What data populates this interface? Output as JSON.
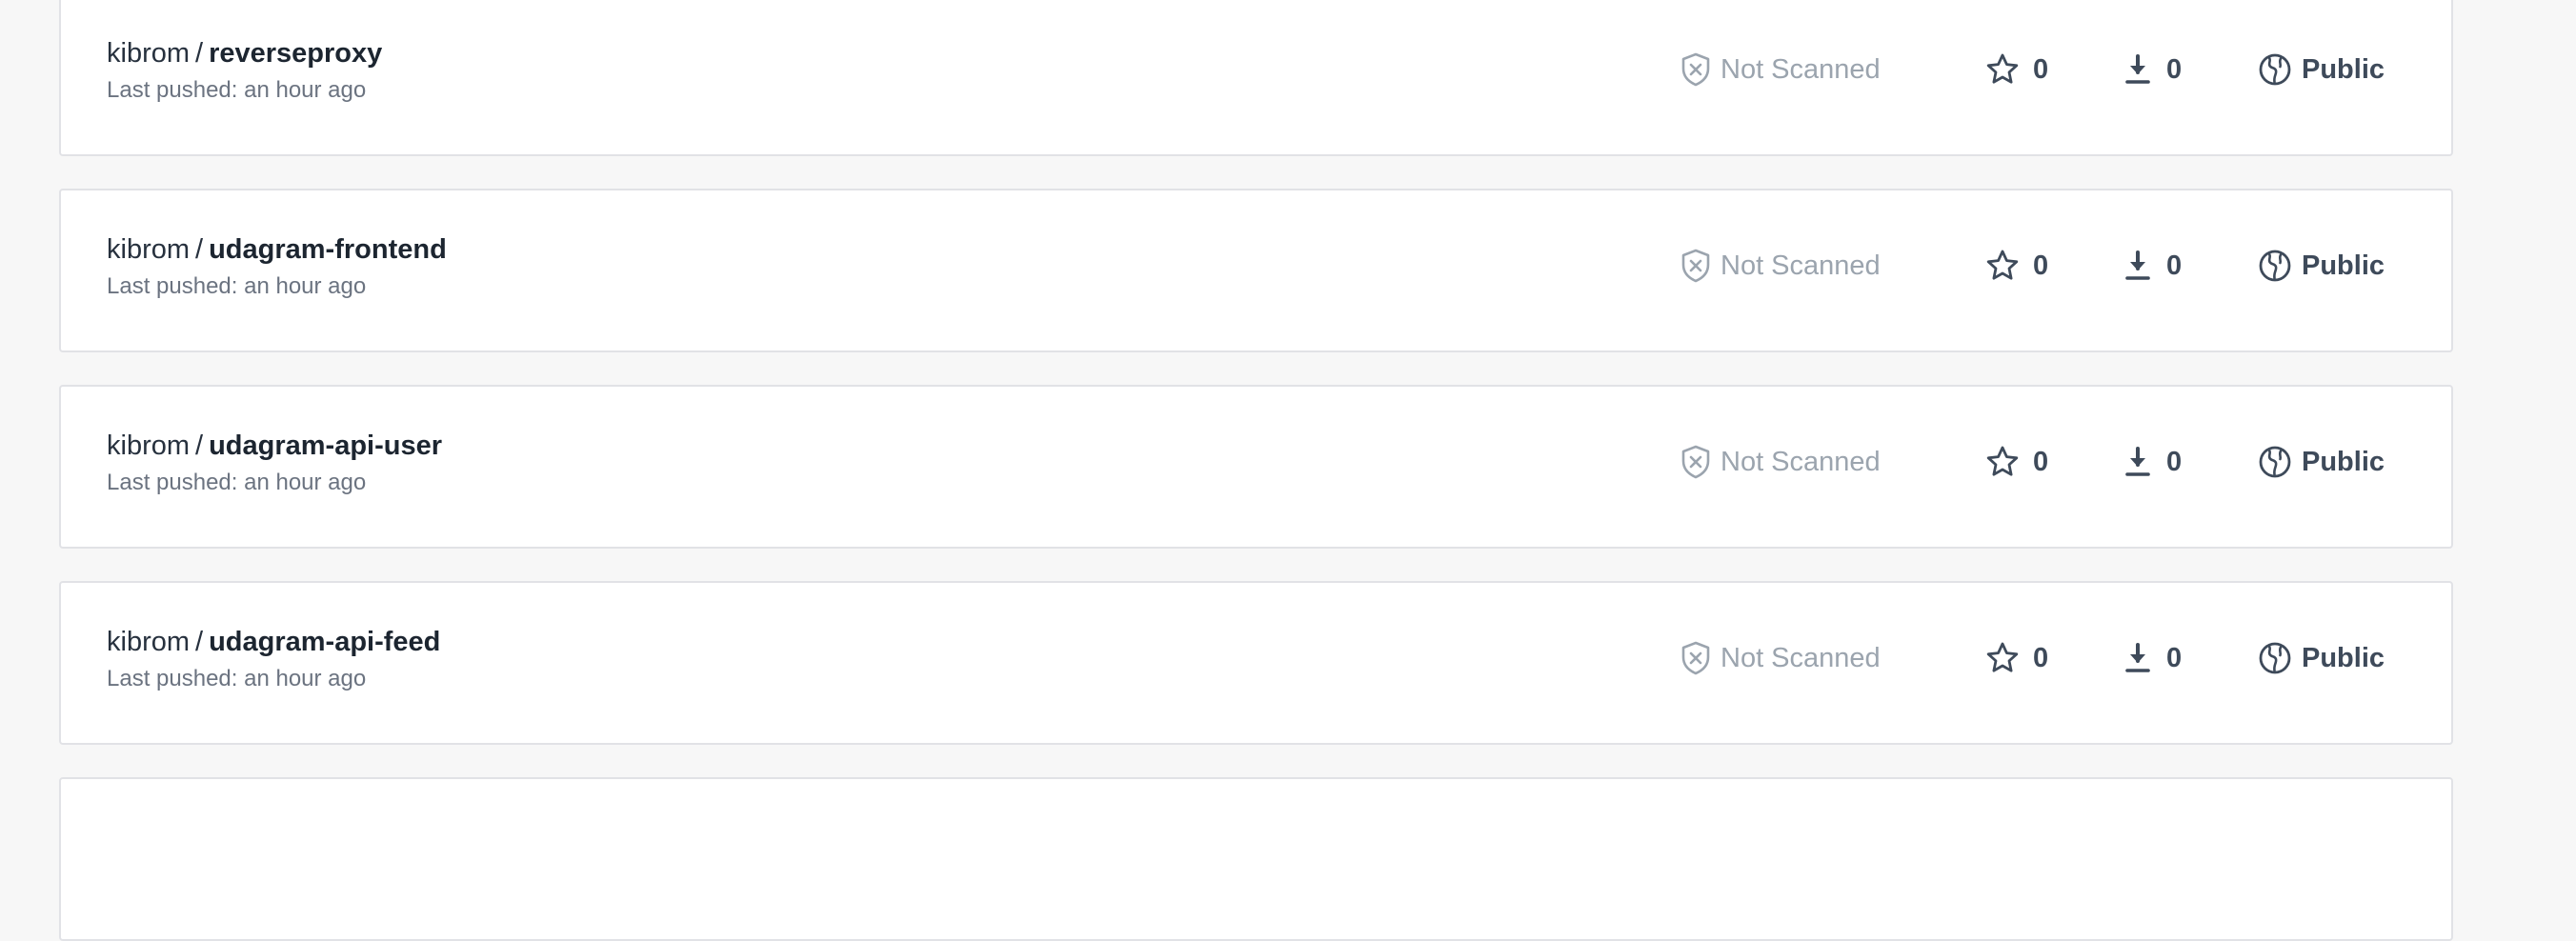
{
  "repositories": [
    {
      "namespace": "kibrom",
      "separator": "/",
      "name": "reverseproxy",
      "last_pushed": "Last pushed: an hour ago",
      "scan_status": "Not Scanned",
      "stars": "0",
      "pulls": "0",
      "visibility": "Public"
    },
    {
      "namespace": "kibrom",
      "separator": "/",
      "name": "udagram-frontend",
      "last_pushed": "Last pushed: an hour ago",
      "scan_status": "Not Scanned",
      "stars": "0",
      "pulls": "0",
      "visibility": "Public"
    },
    {
      "namespace": "kibrom",
      "separator": "/",
      "name": "udagram-api-user",
      "last_pushed": "Last pushed: an hour ago",
      "scan_status": "Not Scanned",
      "stars": "0",
      "pulls": "0",
      "visibility": "Public"
    },
    {
      "namespace": "kibrom",
      "separator": "/",
      "name": "udagram-api-feed",
      "last_pushed": "Last pushed: an hour ago",
      "scan_status": "Not Scanned",
      "stars": "0",
      "pulls": "0",
      "visibility": "Public"
    }
  ],
  "icons": {
    "scan": "shield-x-icon",
    "stars": "star-icon",
    "pulls": "download-icon",
    "visibility": "globe-icon"
  },
  "colors": {
    "page_background": "#f7f7f7",
    "card_background": "#ffffff",
    "card_border": "#e1e2e6",
    "muted_text": "#9ba4ae",
    "primary_text": "#27313e"
  }
}
